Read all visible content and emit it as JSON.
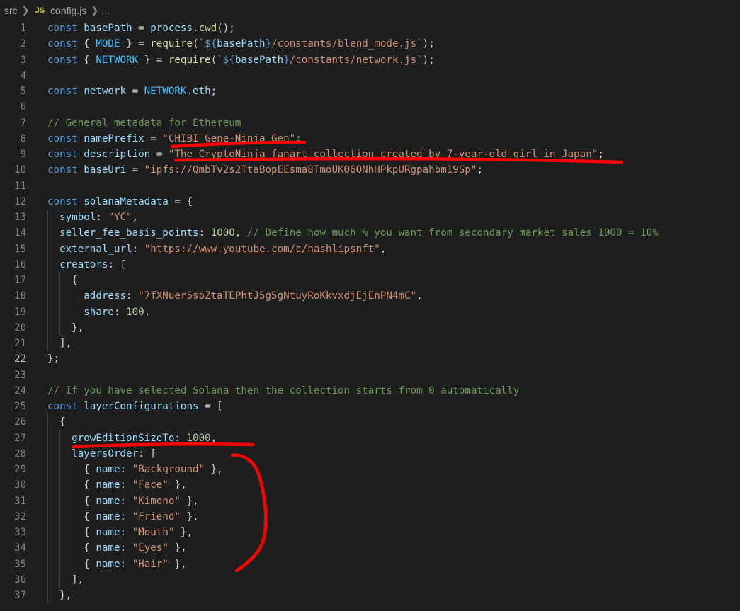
{
  "breadcrumb": {
    "folder": "src",
    "file_icon": "JS",
    "file": "config.js",
    "rest": "..."
  },
  "annotation_color": "#ff0000",
  "current_line": 22,
  "lines": [
    [
      [
        "k",
        "const "
      ],
      [
        "v",
        "basePath"
      ],
      [
        "p",
        " = "
      ],
      [
        "v",
        "process"
      ],
      [
        "p",
        "."
      ],
      [
        "f",
        "cwd"
      ],
      [
        "p",
        "();"
      ]
    ],
    [
      [
        "k",
        "const "
      ],
      [
        "p",
        "{ "
      ],
      [
        "c",
        "MODE"
      ],
      [
        "p",
        " } = "
      ],
      [
        "f",
        "require"
      ],
      [
        "p",
        "("
      ],
      [
        "s",
        "`"
      ],
      [
        "k",
        "${"
      ],
      [
        "v",
        "basePath"
      ],
      [
        "k",
        "}"
      ],
      [
        "s",
        "/constants/blend_mode.js`"
      ],
      [
        "p",
        ");"
      ]
    ],
    [
      [
        "k",
        "const "
      ],
      [
        "p",
        "{ "
      ],
      [
        "c",
        "NETWORK"
      ],
      [
        "p",
        " } = "
      ],
      [
        "f",
        "require"
      ],
      [
        "p",
        "("
      ],
      [
        "s",
        "`"
      ],
      [
        "k",
        "${"
      ],
      [
        "v",
        "basePath"
      ],
      [
        "k",
        "}"
      ],
      [
        "s",
        "/constants/network.js`"
      ],
      [
        "p",
        ");"
      ]
    ],
    [],
    [
      [
        "k",
        "const "
      ],
      [
        "v",
        "network"
      ],
      [
        "p",
        " = "
      ],
      [
        "c",
        "NETWORK"
      ],
      [
        "p",
        "."
      ],
      [
        "v",
        "eth"
      ],
      [
        "p",
        ";"
      ]
    ],
    [],
    [
      [
        "cm",
        "// General metadata for Ethereum"
      ]
    ],
    [
      [
        "k",
        "const "
      ],
      [
        "v",
        "namePrefix"
      ],
      [
        "p",
        " = "
      ],
      [
        "s",
        "\"CHIBI Gene-Ninja Gen\""
      ],
      [
        "p",
        ";"
      ]
    ],
    [
      [
        "k",
        "const "
      ],
      [
        "v",
        "description"
      ],
      [
        "p",
        " = "
      ],
      [
        "s",
        "\"The CryptoNinja fanart collection created by 7-year-old girl in Japan\""
      ],
      [
        "p",
        ";"
      ]
    ],
    [
      [
        "k",
        "const "
      ],
      [
        "v",
        "baseUri"
      ],
      [
        "p",
        " = "
      ],
      [
        "s",
        "\"ipfs://QmbTv2s2TtaBopEEsma8TmoUKQ6QNhHPkpURgpahbm19Sp\""
      ],
      [
        "p",
        ";"
      ]
    ],
    [],
    [
      [
        "k",
        "const "
      ],
      [
        "v",
        "solanaMetadata"
      ],
      [
        "p",
        " = {"
      ]
    ],
    [
      [
        "p",
        "  "
      ],
      [
        "v",
        "symbol"
      ],
      [
        "p",
        ": "
      ],
      [
        "s",
        "\"YC\""
      ],
      [
        "p",
        ","
      ]
    ],
    [
      [
        "p",
        "  "
      ],
      [
        "v",
        "seller_fee_basis_points"
      ],
      [
        "p",
        ": "
      ],
      [
        "n",
        "1000"
      ],
      [
        "p",
        ", "
      ],
      [
        "cm",
        "// Define how much % you want from secondary market sales 1000 = 10%"
      ]
    ],
    [
      [
        "p",
        "  "
      ],
      [
        "v",
        "external_url"
      ],
      [
        "p",
        ": "
      ],
      [
        "s",
        "\""
      ],
      [
        "su",
        "https://www.youtube.com/c/hashlipsnft"
      ],
      [
        "s",
        "\""
      ],
      [
        "p",
        ","
      ]
    ],
    [
      [
        "p",
        "  "
      ],
      [
        "v",
        "creators"
      ],
      [
        "p",
        ": ["
      ]
    ],
    [
      [
        "p",
        "    {"
      ]
    ],
    [
      [
        "p",
        "      "
      ],
      [
        "v",
        "address"
      ],
      [
        "p",
        ": "
      ],
      [
        "s",
        "\"7fXNuer5sbZtaTEPhtJ5g5gNtuyRoKkvxdjEjEnPN4mC\""
      ],
      [
        "p",
        ","
      ]
    ],
    [
      [
        "p",
        "      "
      ],
      [
        "v",
        "share"
      ],
      [
        "p",
        ": "
      ],
      [
        "n",
        "100"
      ],
      [
        "p",
        ","
      ]
    ],
    [
      [
        "p",
        "    },"
      ]
    ],
    [
      [
        "p",
        "  ],"
      ]
    ],
    [
      [
        "p",
        "};"
      ]
    ],
    [],
    [
      [
        "cm",
        "// If you have selected Solana then the collection starts from 0 automatically"
      ]
    ],
    [
      [
        "k",
        "const "
      ],
      [
        "v",
        "layerConfigurations"
      ],
      [
        "p",
        " = ["
      ]
    ],
    [
      [
        "p",
        "  {"
      ]
    ],
    [
      [
        "p",
        "    "
      ],
      [
        "v",
        "growEditionSizeTo"
      ],
      [
        "p",
        ": "
      ],
      [
        "n",
        "1000"
      ],
      [
        "p",
        ","
      ]
    ],
    [
      [
        "p",
        "    "
      ],
      [
        "v",
        "layersOrder"
      ],
      [
        "p",
        ": ["
      ]
    ],
    [
      [
        "p",
        "      { "
      ],
      [
        "v",
        "name"
      ],
      [
        "p",
        ": "
      ],
      [
        "s",
        "\"Background\""
      ],
      [
        "p",
        " },"
      ]
    ],
    [
      [
        "p",
        "      { "
      ],
      [
        "v",
        "name"
      ],
      [
        "p",
        ": "
      ],
      [
        "s",
        "\"Face\""
      ],
      [
        "p",
        " },"
      ]
    ],
    [
      [
        "p",
        "      { "
      ],
      [
        "v",
        "name"
      ],
      [
        "p",
        ": "
      ],
      [
        "s",
        "\"Kimono\""
      ],
      [
        "p",
        " },"
      ]
    ],
    [
      [
        "p",
        "      { "
      ],
      [
        "v",
        "name"
      ],
      [
        "p",
        ": "
      ],
      [
        "s",
        "\"Friend\""
      ],
      [
        "p",
        " },"
      ]
    ],
    [
      [
        "p",
        "      { "
      ],
      [
        "v",
        "name"
      ],
      [
        "p",
        ": "
      ],
      [
        "s",
        "\"Mouth\""
      ],
      [
        "p",
        " },"
      ]
    ],
    [
      [
        "p",
        "      { "
      ],
      [
        "v",
        "name"
      ],
      [
        "p",
        ": "
      ],
      [
        "s",
        "\"Eyes\""
      ],
      [
        "p",
        " },"
      ]
    ],
    [
      [
        "p",
        "      { "
      ],
      [
        "v",
        "name"
      ],
      [
        "p",
        ": "
      ],
      [
        "s",
        "\"Hair\""
      ],
      [
        "p",
        " },"
      ]
    ],
    [
      [
        "p",
        "    ],"
      ]
    ],
    [
      [
        "p",
        "  },"
      ]
    ]
  ]
}
